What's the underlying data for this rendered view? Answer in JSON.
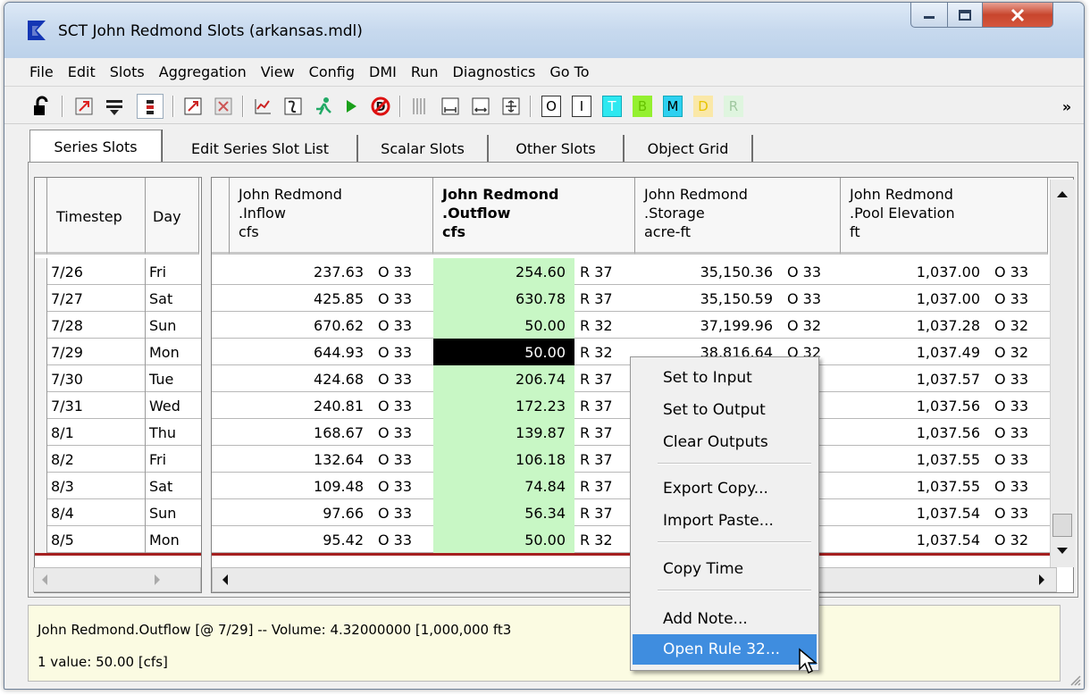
{
  "window": {
    "title": "SCT John Redmond Slots (arkansas.mdl)"
  },
  "menu": [
    "File",
    "Edit",
    "Slots",
    "Aggregation",
    "View",
    "Config",
    "DMI",
    "Run",
    "Diagnostics",
    "Go To"
  ],
  "toolbar": {
    "letters": [
      "O",
      "I",
      "T",
      "B",
      "M",
      "D",
      "R"
    ],
    "letter_colors": [
      "#000000",
      "#000000",
      "#ffffff",
      "#66c200",
      "#000000",
      "#e8c400",
      "#a0c8a0"
    ],
    "letter_bgs": [
      "#ffffff",
      "#ffffff",
      "#2ee8f0",
      "#94f030",
      "#2ed0f0",
      "#fae8a8",
      "#dff5df"
    ],
    "overflow": "»"
  },
  "tabs": [
    "Series Slots",
    "Edit Series Slot List",
    "Scalar Slots",
    "Other Slots",
    "Object Grid"
  ],
  "grid": {
    "time_headers": [
      "Timestep",
      "Day"
    ],
    "columns": [
      {
        "line1": "John Redmond",
        "line2": ".Inflow",
        "units": "cfs"
      },
      {
        "line1": "John Redmond",
        "line2": ".Outflow",
        "units": "cfs"
      },
      {
        "line1": "John Redmond",
        "line2": ".Storage",
        "units": "acre-ft"
      },
      {
        "line1": "John Redmond",
        "line2": ".Pool Elevation",
        "units": "ft"
      }
    ],
    "rows": [
      {
        "date": "7/26",
        "day": "Fri",
        "inflow": "237.63",
        "if": "O 33",
        "outflow": "254.60",
        "of": "R 37",
        "storage": "35,150.36",
        "sf": "O 33",
        "pool": "1,037.00",
        "pf": "O 33"
      },
      {
        "date": "7/27",
        "day": "Sat",
        "inflow": "425.85",
        "if": "O 33",
        "outflow": "630.78",
        "of": "R 37",
        "storage": "35,150.59",
        "sf": "O 33",
        "pool": "1,037.00",
        "pf": "O 33"
      },
      {
        "date": "7/28",
        "day": "Sun",
        "inflow": "670.62",
        "if": "O 33",
        "outflow": "50.00",
        "of": "R 32",
        "storage": "37,199.96",
        "sf": "O 32",
        "pool": "1,037.28",
        "pf": "O 32"
      },
      {
        "date": "7/29",
        "day": "Mon",
        "inflow": "644.93",
        "if": "O 33",
        "outflow": "50.00",
        "of": "R 32",
        "storage": "38,816.64",
        "sf": "O 32",
        "pool": "1,037.49",
        "pf": "O 32"
      },
      {
        "date": "7/30",
        "day": "Tue",
        "inflow": "424.68",
        "if": "O 33",
        "outflow": "206.74",
        "of": "R 37",
        "storage": "",
        "sf": "33",
        "pool": "1,037.57",
        "pf": "O 33"
      },
      {
        "date": "7/31",
        "day": "Wed",
        "inflow": "240.81",
        "if": "O 33",
        "outflow": "172.23",
        "of": "R 37",
        "storage": "",
        "sf": "33",
        "pool": "1,037.56",
        "pf": "O 33"
      },
      {
        "date": "8/1",
        "day": "Thu",
        "inflow": "168.67",
        "if": "O 33",
        "outflow": "139.87",
        "of": "R 37",
        "storage": "",
        "sf": "33",
        "pool": "1,037.56",
        "pf": "O 33"
      },
      {
        "date": "8/2",
        "day": "Fri",
        "inflow": "132.64",
        "if": "O 33",
        "outflow": "106.18",
        "of": "R 37",
        "storage": "",
        "sf": "33",
        "pool": "1,037.55",
        "pf": "O 33"
      },
      {
        "date": "8/3",
        "day": "Sat",
        "inflow": "109.48",
        "if": "O 33",
        "outflow": "74.84",
        "of": "R 37",
        "storage": "",
        "sf": "33",
        "pool": "1,037.55",
        "pf": "O 33"
      },
      {
        "date": "8/4",
        "day": "Sun",
        "inflow": "97.66",
        "if": "O 33",
        "outflow": "56.34",
        "of": "R 37",
        "storage": "",
        "sf": "33",
        "pool": "1,037.54",
        "pf": "O 33"
      },
      {
        "date": "8/5",
        "day": "Mon",
        "inflow": "95.42",
        "if": "O 33",
        "outflow": "50.00",
        "of": "R 32",
        "storage": "",
        "sf": "32",
        "pool": "1,037.54",
        "pf": "O 32"
      }
    ]
  },
  "context_menu": {
    "items": [
      "Set to Input",
      "Set to Output",
      "Clear Outputs",
      "Export Copy...",
      "Import Paste...",
      "Copy Time",
      "Add Note...",
      "Open Rule 32..."
    ],
    "highlighted": "Open Rule 32..."
  },
  "status": {
    "line1": "John Redmond.Outflow [@ 7/29] -- Volume: 4.32000000 [1,000,000 ft3",
    "line2": "1 value:  50.00 [cfs]"
  },
  "colors": {
    "selected_column_bg": "#c8f7c5",
    "menu_highlight": "#3f8ddf",
    "status_bg": "#fbfbe2"
  }
}
